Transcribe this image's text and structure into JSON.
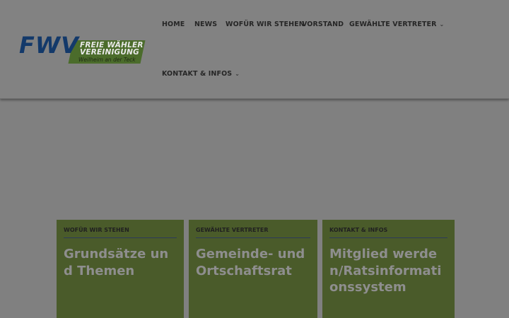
{
  "logo": {
    "abbr": "FWV",
    "line1": "FREIE WÄHLER",
    "line2": "VEREINIGUNG",
    "line3": "Weilheim an der Teck"
  },
  "nav": {
    "items": [
      {
        "label": "HOME"
      },
      {
        "label": "NEWS"
      },
      {
        "label": "WOFÜR WIR STEHEN"
      },
      {
        "label": "VORSTAND"
      },
      {
        "label": "GEWÄHLTE VERTRETER",
        "has_submenu": true
      },
      {
        "label": "KONTAKT & INFOS",
        "has_submenu": true
      }
    ],
    "chevron": "⌄"
  },
  "cards": [
    {
      "category": "WOFÜR WIR STEHEN",
      "title": "Grundsätze und Themen"
    },
    {
      "category": "GEWÄHLTE VERTRETER",
      "title": "Gemeinde- und Ortschaftsrat"
    },
    {
      "category": "KONTAKT & INFOS",
      "title": "Mitglied werden/Ratsinformationssystem"
    }
  ],
  "colors": {
    "overlay": "#808080",
    "card_bg": "#4a5b2a",
    "logo_blue": "#13396a",
    "logo_green": "#4b6c2b"
  }
}
